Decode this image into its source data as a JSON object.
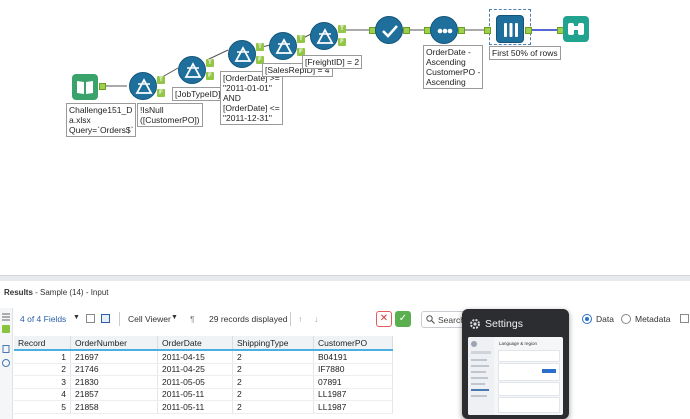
{
  "workflow": {
    "input_annotation": "Challenge151_D\na.xlsx\nQuery=`Orders$`",
    "filter1_annotation": "!IsNull\n([CustomerPO])",
    "filter2_annotation": "[JobTypeID]",
    "filter3_annotation": "[OrderDate] >=\n\"2011-01-01\"\nAND\n[OrderDate] <=\n\"2011-12-31\"",
    "filter4_annotation": "[SalesRepID] = 4",
    "filter5_annotation": "[FreightID] = 2",
    "sort_annotation": "OrderDate -\nAscending\nCustomerPO -\nAscending",
    "sample_annotation": "First 50% of rows",
    "anchor_true": "T",
    "anchor_false": "F"
  },
  "results": {
    "title_bold": "Results",
    "title_rest": " - Sample (14) - Input",
    "fields_label": "4 of 4 Fields",
    "viewer_label": "Cell Viewer",
    "records_label": "29 records displayed",
    "search_label": "Search",
    "data_label": "Data",
    "metadata_label": "Metadata",
    "columns": [
      "Record",
      "OrderNumber",
      "OrderDate",
      "ShippingType",
      "CustomerPO"
    ],
    "rows": [
      [
        "1",
        "21697",
        "2011-04-15",
        "2",
        "B04191"
      ],
      [
        "2",
        "21746",
        "2011-04-25",
        "2",
        "IF7880"
      ],
      [
        "3",
        "21830",
        "2011-05-05",
        "2",
        "07891"
      ],
      [
        "4",
        "21857",
        "2011-05-11",
        "2",
        "LL1987"
      ],
      [
        "5",
        "21858",
        "2011-05-11",
        "2",
        "LL1987"
      ]
    ]
  },
  "settings_popup": {
    "title": "Settings",
    "preview_heading": "Language & region"
  },
  "colors": {
    "tool_blue": "#1f6f9c",
    "anchor_green": "#93c546",
    "browse_teal": "#22a38f",
    "input_green": "#3aa36b",
    "selection_accent": "#4bb0e0"
  },
  "icons": {
    "input": "book-icon",
    "filter": "filter-triangle-icon",
    "select": "checkmark-icon",
    "sort": "sort-dots-icon",
    "sample": "sample-tubes-icon",
    "browse": "binoculars-icon"
  }
}
